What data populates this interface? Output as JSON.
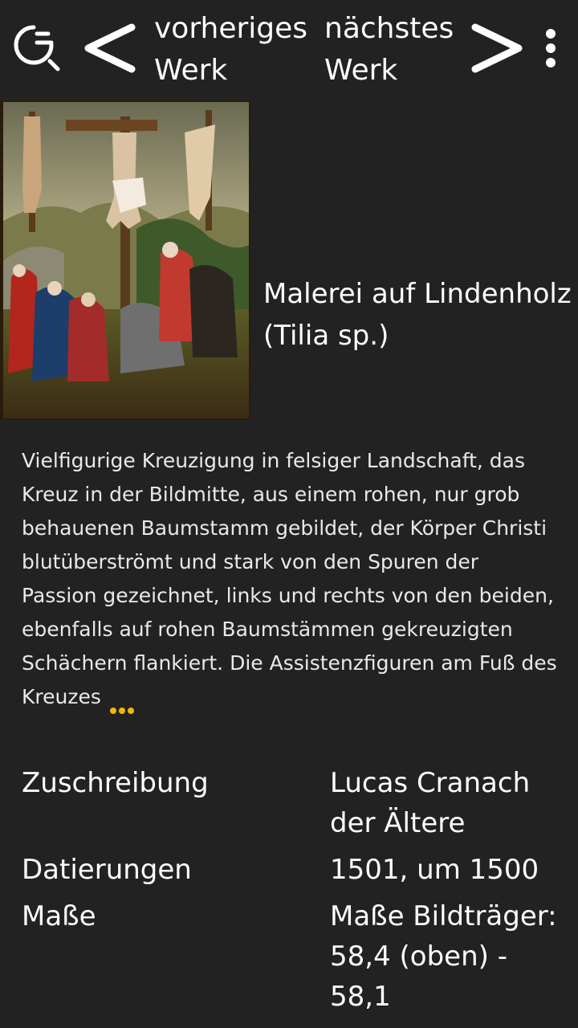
{
  "header": {
    "prev_line1": "vorheriges",
    "prev_line2": "Werk",
    "next_line1": "nächstes",
    "next_line2": "Werk",
    "icons": [
      "search-icon",
      "chevron-left-icon",
      "chevron-right-icon",
      "more-vertical-icon"
    ]
  },
  "artwork": {
    "material": "Malerei auf Lindenholz (Tilia sp.)",
    "description": "Vielfigurige Kreuzigung in felsiger Landschaft, das Kreuz in der Bildmitte, aus einem rohen, nur grob behauenen Baumstamm gebildet, der Körper Christi blutüberströmt und stark von den Spuren der Passion gezeichnet, links und rechts von den beiden, ebenfalls auf rohen Baumstämmen gekreuzigten Schächern flankiert. Die Assistenzfiguren am Fuß des Kreuzes"
  },
  "details": [
    {
      "label": "Zuschreibung",
      "value": "Lucas Cranach der Ältere"
    },
    {
      "label": "Datierungen",
      "value": "1501, um 1500"
    },
    {
      "label": "Maße",
      "value": "Maße Bildträger: 58,4 (oben) - 58,1"
    }
  ],
  "colors": {
    "background": "#222222",
    "accent_dots": "#f2b705"
  }
}
